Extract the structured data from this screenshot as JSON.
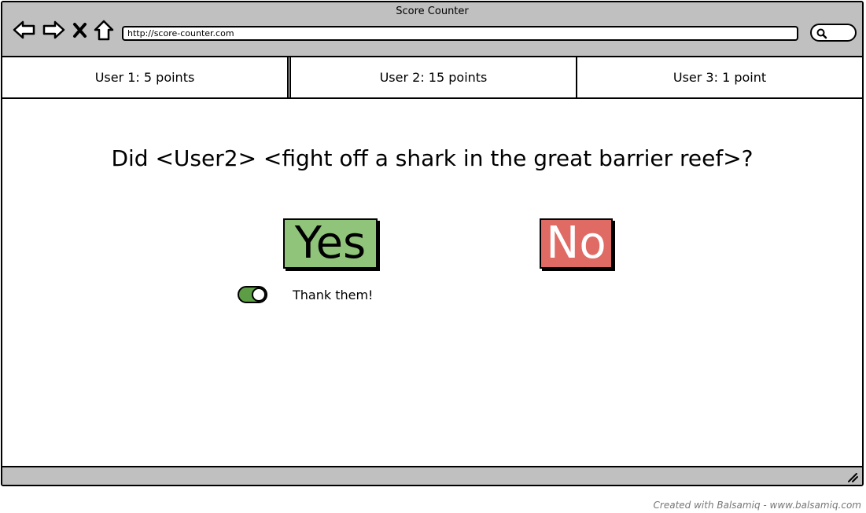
{
  "window": {
    "title": "Score Counter"
  },
  "toolbar": {
    "icons": [
      "back-arrow-icon",
      "forward-arrow-icon",
      "close-x-icon",
      "home-icon"
    ],
    "url": "http://score-counter.com",
    "search_icon": "search-icon"
  },
  "tabs": [
    {
      "label": "User 1: 5 points"
    },
    {
      "label": "User 2: 15 points",
      "active": true
    },
    {
      "label": "User 3: 1 point"
    }
  ],
  "main": {
    "question": "Did <User2> <fight off a shark in the great barrier reef>?",
    "yes_label": "Yes",
    "no_label": "No",
    "toggle": {
      "checked": true,
      "label": "Thank them!"
    }
  },
  "colors": {
    "chrome": "#c0c0c0",
    "yes": "#8fc47a",
    "no": "#e06a64",
    "toggle_on": "#5c9d45"
  },
  "footer": {
    "credit": "Created with Balsamiq - www.balsamiq.com"
  }
}
